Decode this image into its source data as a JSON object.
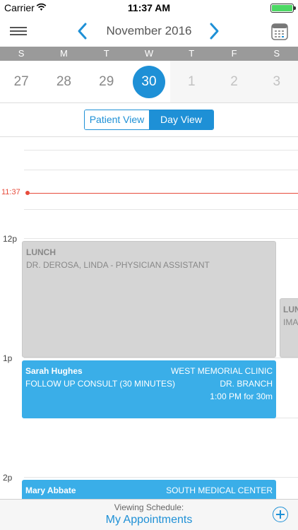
{
  "status_bar": {
    "carrier": "Carrier",
    "time": "11:37 AM"
  },
  "nav": {
    "month_title": "November 2016"
  },
  "week": {
    "day_letters": [
      "S",
      "M",
      "T",
      "W",
      "T",
      "F",
      "S"
    ],
    "dates": [
      "27",
      "28",
      "29",
      "30",
      "1",
      "2",
      "3"
    ],
    "selected_date": "30"
  },
  "view_toggle": {
    "patient_view": "Patient View",
    "day_view": "Day View",
    "selected": "Day View"
  },
  "timeline": {
    "current_time": "11:37",
    "hour_labels": {
      "noon": "12p",
      "one": "1p",
      "two": "2p"
    }
  },
  "events": {
    "lunch_1": {
      "title": "LUNCH",
      "subtitle": "DR. DEROSA, LINDA - PHYSICIAN ASSISTANT"
    },
    "lunch_2": {
      "title": "LUN",
      "subtitle": "IMA"
    },
    "appt_1": {
      "patient": "Sarah Hughes",
      "location": "WEST MEMORIAL CLINIC",
      "type": "FOLLOW UP CONSULT (30 MINUTES)",
      "provider": "DR. BRANCH",
      "time": "1:00 PM for 30m"
    },
    "appt_2": {
      "patient": "Mary Abbate",
      "location": "SOUTH MEDICAL CENTER"
    }
  },
  "footer": {
    "caption": "Viewing Schedule:",
    "schedule_name": "My Appointments"
  },
  "colors": {
    "accent": "#1e90d6",
    "appointment": "#3aaee8",
    "now_line": "#e74c3c",
    "lunch": "#d5d5d5"
  },
  "icons": [
    "wifi-icon",
    "battery-icon",
    "menu-icon",
    "chevron-left-icon",
    "chevron-right-icon",
    "calendar-icon",
    "add-icon"
  ]
}
